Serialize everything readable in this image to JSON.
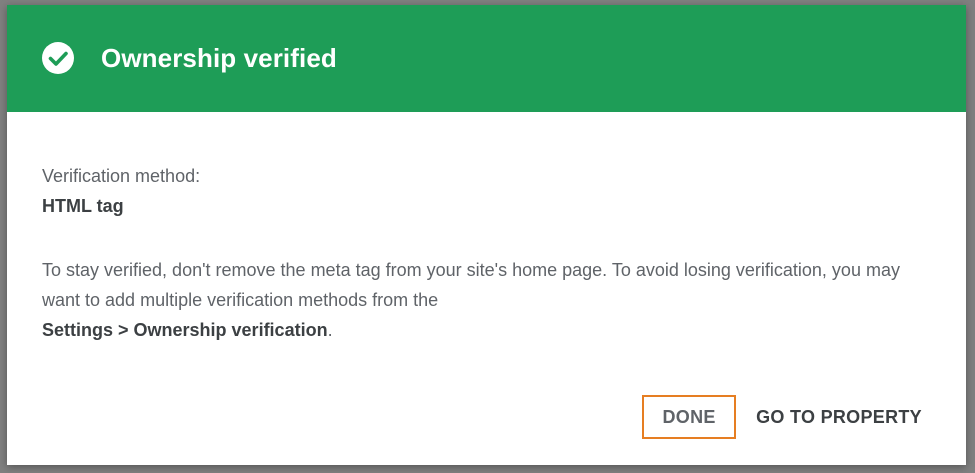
{
  "dialog": {
    "title": "Ownership verified",
    "header_color": "#1e9d57",
    "icon": "check-circle-icon",
    "method_label": "Verification method:",
    "method_value": "HTML tag",
    "notice_text": "To stay verified, don't remove the meta tag from your site's home page. To avoid losing verification, you may want to add multiple verification methods from the",
    "notice_link": "Settings > Ownership verification",
    "notice_end": ".",
    "buttons": {
      "done": "DONE",
      "go_to_property": "GO TO PROPERTY"
    },
    "focus_outline_color": "#e67e22"
  }
}
